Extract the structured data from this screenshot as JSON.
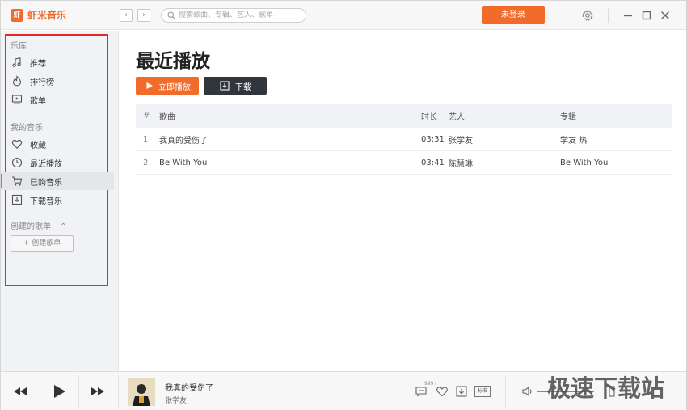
{
  "app": {
    "name": "虾米音乐",
    "logo_glyph": "虾",
    "brand_color": "#f26b2a"
  },
  "titlebar": {
    "search_placeholder": "搜索歌曲、专辑、艺人、歌单",
    "login_label": "未登录"
  },
  "sidebar": {
    "library_title": "乐库",
    "library_items": [
      {
        "label": "推荐",
        "icon": "music-note-icon"
      },
      {
        "label": "排行榜",
        "icon": "flame-icon"
      },
      {
        "label": "歌单",
        "icon": "playlist-icon"
      }
    ],
    "my_music_title": "我的音乐",
    "my_music_items": [
      {
        "label": "收藏",
        "icon": "heart-icon"
      },
      {
        "label": "最近播放",
        "icon": "clock-icon"
      },
      {
        "label": "已购音乐",
        "icon": "cart-icon",
        "active": true
      },
      {
        "label": "下载音乐",
        "icon": "download-icon"
      }
    ],
    "created_title": "创建的歌单",
    "create_button": "+ 创建歌单"
  },
  "main": {
    "title": "最近播放",
    "play_all_label": "立即播放",
    "download_label": "下载",
    "columns": [
      "#",
      "歌曲",
      "时长",
      "艺人",
      "专辑"
    ],
    "rows": [
      {
        "num": "1",
        "song": "我真的受伤了",
        "duration": "03:31",
        "artist": "张学友",
        "album": "学友 热"
      },
      {
        "num": "2",
        "song": "Be With You",
        "duration": "03:41",
        "artist": "陈慧琳",
        "album": "Be With You"
      }
    ]
  },
  "player": {
    "track_title": "我真的受伤了",
    "track_artist": "张学友",
    "comment_count": "999+",
    "quality_label": "标准"
  },
  "watermark": "极速下载站"
}
